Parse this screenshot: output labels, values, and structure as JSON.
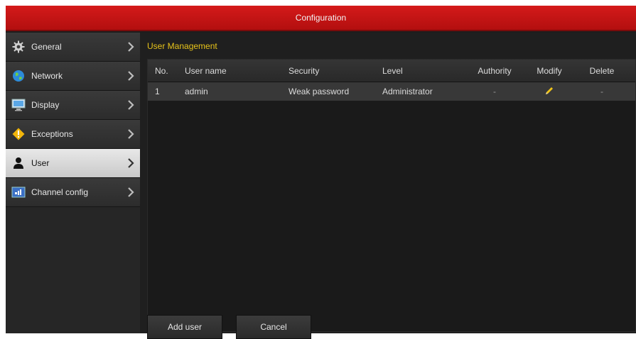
{
  "window": {
    "title": "Configuration"
  },
  "sidebar": {
    "items": [
      {
        "label": "General",
        "icon": "gear-icon"
      },
      {
        "label": "Network",
        "icon": "globe-icon"
      },
      {
        "label": "Display",
        "icon": "monitor-icon"
      },
      {
        "label": "Exceptions",
        "icon": "warning-icon"
      },
      {
        "label": "User",
        "icon": "user-icon",
        "active": true
      },
      {
        "label": "Channel config",
        "icon": "channel-icon"
      }
    ]
  },
  "main": {
    "title": "User Management",
    "table": {
      "columns": [
        "No.",
        "User name",
        "Security",
        "Level",
        "Authority",
        "Modify",
        "Delete"
      ],
      "rows": [
        {
          "no": "1",
          "user": "admin",
          "security": "Weak password",
          "level": "Administrator",
          "authority": "-",
          "modify": "pencil-icon",
          "delete": "-"
        }
      ]
    }
  },
  "buttons": {
    "add_user": "Add user",
    "cancel": "Cancel"
  },
  "colors": {
    "title_bar": "#c81414",
    "section_title": "#e6c21a",
    "modify_icon": "#f0c419"
  }
}
